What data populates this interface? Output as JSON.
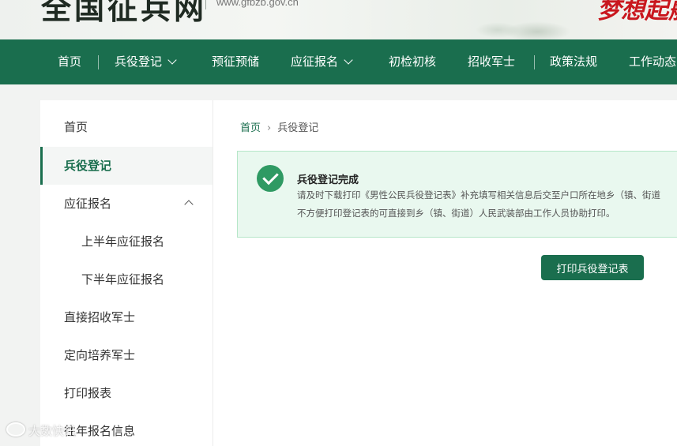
{
  "header": {
    "site_name": "全国征兵网",
    "url": "www.gfbzb.gov.cn",
    "slogan": "梦想起航"
  },
  "nav": {
    "items": [
      {
        "label": "首页"
      },
      {
        "label": "兵役登记",
        "has_dropdown": true
      },
      {
        "label": "预征预储"
      },
      {
        "label": "应征报名",
        "has_dropdown": true
      },
      {
        "label": "初检初核"
      },
      {
        "label": "招收军士"
      },
      {
        "label": "政策法规"
      },
      {
        "label": "工作动态"
      }
    ]
  },
  "sidebar": {
    "items": [
      {
        "label": "首页"
      },
      {
        "label": "兵役登记",
        "active": true
      },
      {
        "label": "应征报名",
        "expanded": true
      },
      {
        "label": "上半年应征报名",
        "sub": true
      },
      {
        "label": "下半年应征报名",
        "sub": true
      },
      {
        "label": "直接招收军士"
      },
      {
        "label": "定向培养军士"
      },
      {
        "label": "打印报表"
      },
      {
        "label": "往年报名信息"
      }
    ]
  },
  "breadcrumb": {
    "home": "首页",
    "current": "兵役登记"
  },
  "alert": {
    "title": "兵役登记完成",
    "line1": "请及时下载打印《男性公民兵役登记表》补充填写相关信息后交至户口所在地乡（镇、街道",
    "line2": "不方便打印登记表的可直接到乡（镇、街道）人民武装部由工作人员协助打印。"
  },
  "print_button": "打印兵役登记表",
  "watermark": "大数快讯",
  "colors": {
    "primary": "#1a6e4e",
    "success": "#2f9a63",
    "alert_bg": "#e9f8ef",
    "slogan": "#c9171e"
  }
}
